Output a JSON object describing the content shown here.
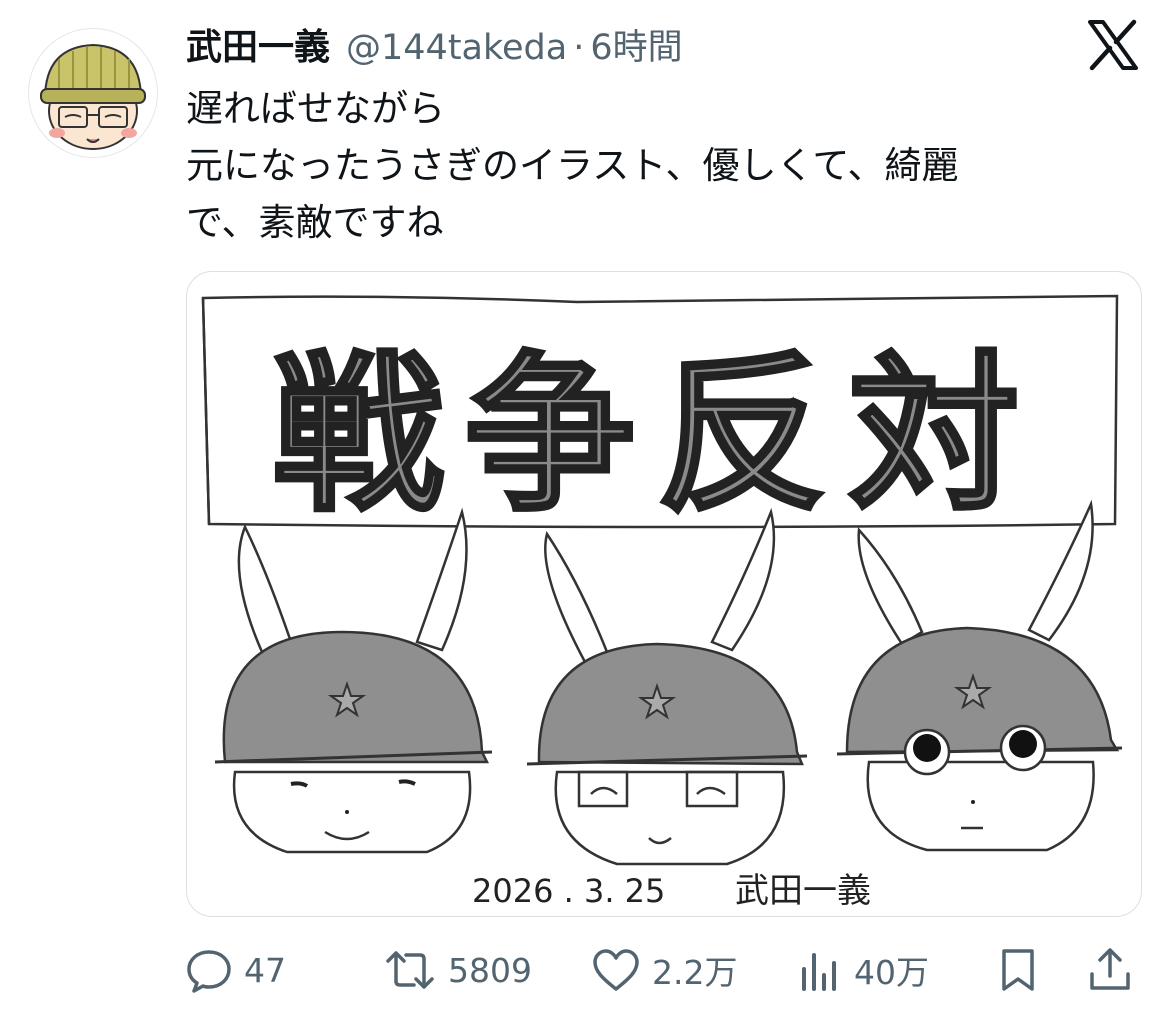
{
  "post": {
    "author_name": "武田一義",
    "handle": "@144takeda",
    "separator": "·",
    "time": "6時間",
    "text_lines": [
      "遅ればせながら",
      "元になったうさぎのイラスト、優しくて、綺麗",
      "で、素敵ですね"
    ]
  },
  "illustration": {
    "banner_text": "戦争反対",
    "date_signature": "2026 . 3. 25",
    "signature": "武田一義"
  },
  "actions": {
    "reply_count": "47",
    "repost_count": "5809",
    "like_count": "2.2万",
    "view_count": "40万"
  },
  "icons": {
    "platform": "x-logo-icon",
    "reply": "reply-icon",
    "repost": "repost-icon",
    "like": "like-icon",
    "views": "views-icon",
    "bookmark": "bookmark-icon",
    "share": "share-icon"
  },
  "colors": {
    "text": "#0f1419",
    "secondary": "#536471",
    "helmet": "#8f8f8f",
    "avatar_hat": "#c9c46a"
  }
}
